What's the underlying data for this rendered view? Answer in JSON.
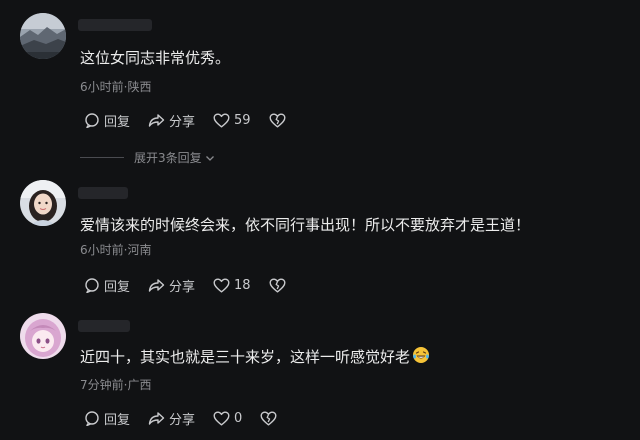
{
  "comments": [
    {
      "text": "这位女同志非常优秀。",
      "meta": "6小时前·陕西",
      "reply_label": "回复",
      "share_label": "分享",
      "like_count": "59",
      "avatar_icon": "landscape-photo-avatar",
      "replies_toggle": "展开3条回复"
    },
    {
      "text": "爱情该来的时候终会来，依不同行事出现！所以不要放弃才是王道！",
      "meta": "6小时前·河南",
      "reply_label": "回复",
      "share_label": "分享",
      "like_count": "18",
      "avatar_icon": "girl-photo-avatar"
    },
    {
      "text": "近四十，其实也就是三十来岁，这样一听感觉好老",
      "meta": "7分钟前·广西",
      "reply_label": "回复",
      "share_label": "分享",
      "like_count": "0",
      "avatar_icon": "anime-girl-avatar",
      "emoji_icon": "laughing-tears-emoji"
    }
  ],
  "colors": {
    "background": "#111214",
    "text": "#ececec",
    "meta": "#8a8b8f",
    "action": "#c9cacd"
  }
}
